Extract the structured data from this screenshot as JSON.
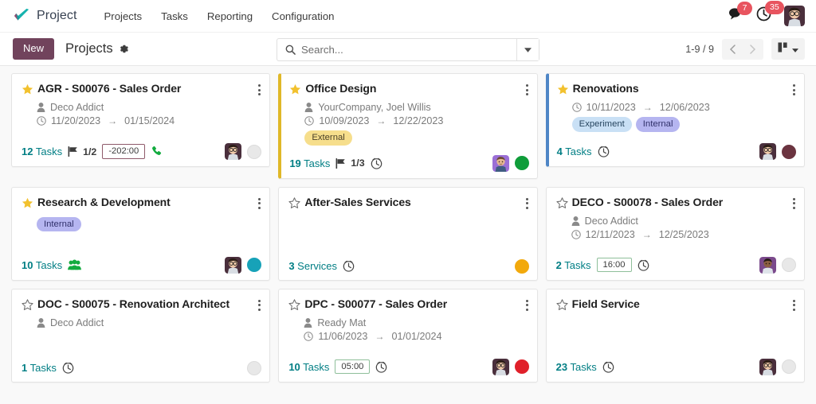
{
  "navbar": {
    "brand": "Project",
    "logo_icon": "checkmark-logo",
    "menu": [
      "Projects",
      "Tasks",
      "Reporting",
      "Configuration"
    ],
    "systray": {
      "messages_icon": "messages-icon",
      "messages_count": "7",
      "activities_icon": "clock-activity-icon",
      "activities_count": "35",
      "avatar_icon": "user-avatar"
    }
  },
  "control_panel": {
    "new_label": "New",
    "breadcrumb_title": "Projects",
    "gear_icon": "gear-icon",
    "search": {
      "icon": "search-icon",
      "placeholder": "Search...",
      "value": "",
      "dropdown_icon": "caret-down-icon"
    },
    "pager": {
      "range": "1-9 / 9",
      "prev_icon": "chevron-left-icon",
      "next_icon": "chevron-right-icon"
    },
    "view_switcher": {
      "icon": "kanban-view-icon",
      "caret": "caret-down-icon"
    }
  },
  "kanban": {
    "cards": [
      {
        "title": "AGR - S00076 - Sales Order",
        "favorite": true,
        "stripe": "none",
        "customer": "Deco Addict",
        "date_start": "11/20/2023",
        "date_end": "01/15/2024",
        "date_arrow": "→",
        "tags": [],
        "count_value": "12",
        "count_label": "Tasks",
        "flag": "1/2",
        "time_badge": "-202:00",
        "time_badge_state": "over",
        "show_clock": false,
        "show_phone": true,
        "show_group": false,
        "avatar": true,
        "status": "gray"
      },
      {
        "title": "Office Design",
        "favorite": true,
        "stripe": "yellow",
        "customer": "YourCompany, Joel Willis",
        "date_start": "10/09/2023",
        "date_end": "12/22/2023",
        "date_arrow": "→",
        "tags": [
          {
            "label": "External",
            "style": "external"
          }
        ],
        "count_value": "19",
        "count_label": "Tasks",
        "flag": "1/3",
        "time_badge": "",
        "time_badge_state": "",
        "show_clock": true,
        "show_phone": false,
        "show_group": false,
        "avatar": true,
        "status": "green"
      },
      {
        "title": "Renovations",
        "favorite": true,
        "stripe": "blue",
        "customer": "",
        "date_start": "10/11/2023",
        "date_end": "12/06/2023",
        "date_arrow": "→",
        "tags": [
          {
            "label": "Experiment",
            "style": "experiment"
          },
          {
            "label": "Internal",
            "style": "internal"
          }
        ],
        "count_value": "4",
        "count_label": "Tasks",
        "flag": "",
        "time_badge": "",
        "time_badge_state": "",
        "show_clock": true,
        "show_phone": false,
        "show_group": false,
        "avatar": true,
        "status": "maroon"
      },
      {
        "title": "Research & Development",
        "favorite": true,
        "stripe": "none",
        "customer": "",
        "date_start": "",
        "date_end": "",
        "date_arrow": "→",
        "tags": [
          {
            "label": "Internal",
            "style": "internal"
          }
        ],
        "count_value": "10",
        "count_label": "Tasks",
        "flag": "",
        "time_badge": "",
        "time_badge_state": "",
        "show_clock": false,
        "show_phone": false,
        "show_group": true,
        "avatar": true,
        "status": "teal"
      },
      {
        "title": "After-Sales Services",
        "favorite": false,
        "stripe": "none",
        "customer": "",
        "date_start": "",
        "date_end": "",
        "date_arrow": "→",
        "tags": [],
        "count_value": "3",
        "count_label": "Services",
        "flag": "",
        "time_badge": "",
        "time_badge_state": "",
        "show_clock": true,
        "show_phone": false,
        "show_group": false,
        "avatar": false,
        "status": "orange"
      },
      {
        "title": "DECO - S00078 - Sales Order",
        "favorite": false,
        "stripe": "none",
        "customer": "Deco Addict",
        "date_start": "12/11/2023",
        "date_end": "12/25/2023",
        "date_arrow": "→",
        "tags": [],
        "count_value": "2",
        "count_label": "Tasks",
        "flag": "",
        "time_badge": "16:00",
        "time_badge_state": "ok",
        "show_clock": true,
        "show_phone": false,
        "show_group": false,
        "avatar": true,
        "status": "gray"
      },
      {
        "title": "DOC - S00075 - Renovation Architect",
        "favorite": false,
        "stripe": "none",
        "customer": "Deco Addict",
        "date_start": "",
        "date_end": "",
        "date_arrow": "→",
        "tags": [],
        "count_value": "1",
        "count_label": "Tasks",
        "flag": "",
        "time_badge": "",
        "time_badge_state": "",
        "show_clock": true,
        "show_phone": false,
        "show_group": false,
        "avatar": false,
        "status": "gray"
      },
      {
        "title": "DPC - S00077 - Sales Order",
        "favorite": false,
        "stripe": "none",
        "customer": "Ready Mat",
        "date_start": "11/06/2023",
        "date_end": "01/01/2024",
        "date_arrow": "→",
        "tags": [],
        "count_value": "10",
        "count_label": "Tasks",
        "flag": "",
        "time_badge": "05:00",
        "time_badge_state": "ok",
        "show_clock": true,
        "show_phone": false,
        "show_group": false,
        "avatar": true,
        "status": "red"
      },
      {
        "title": "Field Service",
        "favorite": false,
        "stripe": "none",
        "customer": "",
        "date_start": "",
        "date_end": "",
        "date_arrow": "→",
        "tags": [],
        "count_value": "23",
        "count_label": "Tasks",
        "flag": "",
        "time_badge": "",
        "time_badge_state": "",
        "show_clock": true,
        "show_phone": false,
        "show_group": false,
        "avatar": true,
        "status": "gray"
      }
    ]
  },
  "colors": {
    "brand_purple": "#71435c",
    "link_teal": "#017e84",
    "badge_red": "#e8545f",
    "stripe_yellow": "#e0b828",
    "stripe_blue": "#4f86c6"
  }
}
